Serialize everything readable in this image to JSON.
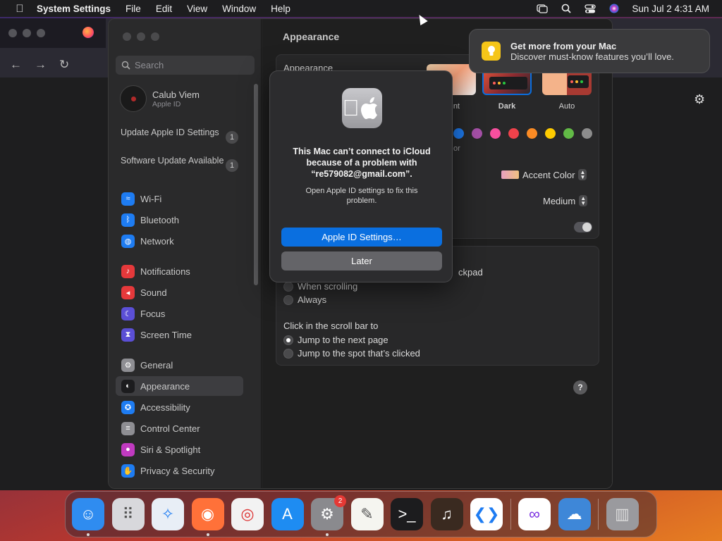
{
  "menubar": {
    "app_name": "System Settings",
    "menus": [
      "File",
      "Edit",
      "View",
      "Window",
      "Help"
    ],
    "clock": "Sun Jul 2  4:31 AM",
    "icons": [
      "screen-mirroring-icon",
      "search-icon",
      "control-center-icon",
      "siri-icon"
    ]
  },
  "sidebar": {
    "search_placeholder": "Search",
    "user": {
      "name": "Calub Viem",
      "subtitle": "Apple ID"
    },
    "notices": [
      {
        "label": "Update Apple ID Settings",
        "count": "1"
      },
      {
        "label": "Software Update Available",
        "count": "1"
      }
    ],
    "items": [
      {
        "label": "Wi-Fi",
        "icon": "wifi-icon",
        "color": "#1e7cf2"
      },
      {
        "label": "Bluetooth",
        "icon": "bluetooth-icon",
        "color": "#1e7cf2"
      },
      {
        "label": "Network",
        "icon": "globe-icon",
        "color": "#1e7cf2"
      },
      {
        "label": "Notifications",
        "icon": "bell-icon",
        "color": "#e5393b"
      },
      {
        "label": "Sound",
        "icon": "speaker-icon",
        "color": "#e5393b"
      },
      {
        "label": "Focus",
        "icon": "moon-icon",
        "color": "#5b4fd6"
      },
      {
        "label": "Screen Time",
        "icon": "hourglass-icon",
        "color": "#5b4fd6"
      },
      {
        "label": "General",
        "icon": "gear-icon",
        "color": "#8e8e93"
      },
      {
        "label": "Appearance",
        "icon": "appearance-icon",
        "color": "#1c1c1e"
      },
      {
        "label": "Accessibility",
        "icon": "accessibility-icon",
        "color": "#1e7cf2"
      },
      {
        "label": "Control Center",
        "icon": "control-center-icon",
        "color": "#8e8e93"
      },
      {
        "label": "Siri & Spotlight",
        "icon": "siri-icon",
        "color": "#c03ac0"
      },
      {
        "label": "Privacy & Security",
        "icon": "hand-icon",
        "color": "#1e7cf2"
      }
    ],
    "active": "Appearance"
  },
  "main": {
    "title": "Appearance",
    "appearance_label": "Appearance",
    "themes": [
      {
        "label": "nt"
      },
      {
        "label": "Dark"
      },
      {
        "label": "Auto"
      }
    ],
    "accent_colors": [
      "#1e7cf2",
      "#a550a7",
      "#f74f9e",
      "#f0424b",
      "#fb8b24",
      "#fecb00",
      "#62ba46",
      "#8c8c8c"
    ],
    "accent_fragment": "or",
    "highlight_select": "Accent Color",
    "sidebar_size_select": "Medium",
    "scroll_fragment": "ckpad",
    "scroll_options": [
      {
        "label": "When scrolling",
        "selected": false
      },
      {
        "label": "Always",
        "selected": false
      }
    ],
    "click_label": "Click in the scroll bar to",
    "click_options": [
      {
        "label": "Jump to the next page",
        "selected": true
      },
      {
        "label": "Jump to the spot that’s clicked",
        "selected": false
      }
    ],
    "help": "?"
  },
  "dialog": {
    "title": "This Mac can’t connect to iCloud because of a problem with “re579082@gmail.com”.",
    "message": "Open Apple ID settings to fix this problem.",
    "primary_button": "Apple ID Settings…",
    "secondary_button": "Later"
  },
  "notification": {
    "title": "Get more from your Mac",
    "body": "Discover must-know features you’ll love."
  },
  "dock": {
    "apps": [
      {
        "name": "finder-icon",
        "color": "#2f8cf0",
        "running": true
      },
      {
        "name": "launchpad-icon",
        "color": "#d8d8dc",
        "running": false
      },
      {
        "name": "safari-icon",
        "color": "#e8eef6",
        "running": false
      },
      {
        "name": "firefox-icon",
        "color": "#ff7139",
        "running": true
      },
      {
        "name": "chrome-icon",
        "color": "#f2f2f2",
        "running": false
      },
      {
        "name": "app-store-icon",
        "color": "#1e8cf2",
        "running": false
      },
      {
        "name": "system-settings-icon",
        "color": "#8a8a8e",
        "running": true,
        "badge": "2"
      },
      {
        "name": "textedit-icon",
        "color": "#f5f5f0",
        "running": false
      },
      {
        "name": "terminal-icon",
        "color": "#1c1c1e",
        "running": false
      },
      {
        "name": "garageband-icon",
        "color": "#3a2a20",
        "running": false
      },
      {
        "name": "vscode-icon",
        "color": "#ffffff",
        "running": false
      }
    ],
    "apps_after_separator": [
      {
        "name": "visual-studio-icon",
        "color": "#ffffff",
        "running": false
      },
      {
        "name": "weather-icon",
        "color": "#3e87d8",
        "running": false
      }
    ],
    "trash": {
      "name": "trash-icon",
      "color": "#9a9a9e"
    }
  }
}
